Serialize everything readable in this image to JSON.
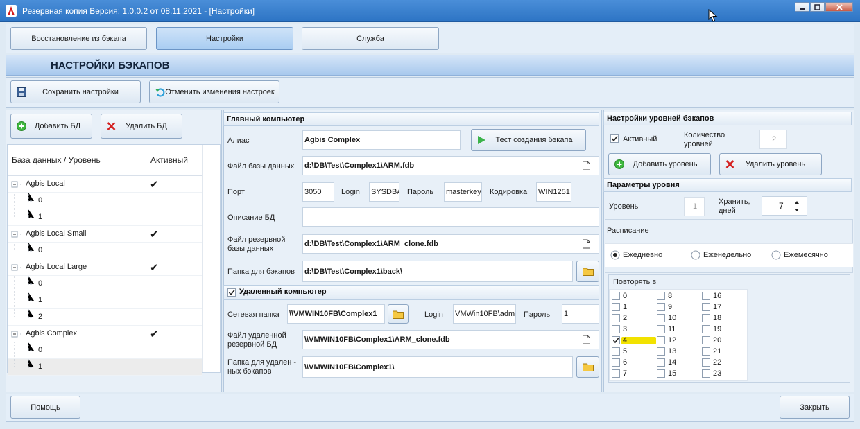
{
  "window": {
    "title": "Резервная копия   Версия: 1.0.0.2 от 08.11.2021 - [Настройки]"
  },
  "tabs": [
    "Восстановление из бэкапа",
    "Настройки",
    "Служба"
  ],
  "header": {
    "title": "НАСТРОЙКИ БЭКАПОВ"
  },
  "toolbar": {
    "save": "Сохранить настройки",
    "cancel": "Отменить изменения настроек"
  },
  "left": {
    "add_db": "Добавить БД",
    "del_db": "Удалить БД",
    "col_db": "База данных / Уровень",
    "col_active": "Активный",
    "rows": [
      {
        "label": "Agbis Local",
        "active": "✔"
      },
      {
        "label": "0",
        "active": ""
      },
      {
        "label": "1",
        "active": ""
      },
      {
        "label": "Agbis Local Small",
        "active": "✔"
      },
      {
        "label": "0",
        "active": ""
      },
      {
        "label": "Agbis Local Large",
        "active": "✔"
      },
      {
        "label": "0",
        "active": ""
      },
      {
        "label": "1",
        "active": ""
      },
      {
        "label": "2",
        "active": ""
      },
      {
        "label": "Agbis Complex",
        "active": "✔"
      },
      {
        "label": "0",
        "active": ""
      },
      {
        "label": "1",
        "active": ""
      }
    ]
  },
  "main": {
    "section": "Главный компьютер",
    "alias_label": "Алиас",
    "alias": "Agbis Complex",
    "test_btn": "Тест создания бэкапа",
    "dbfile_label": "Файл базы данных",
    "dbfile": "d:\\DB\\Test\\Complex1\\ARM.fdb",
    "port_label": "Порт",
    "port": "3050",
    "login_label": "Login",
    "login": "SYSDBA",
    "pass_label": "Пароль",
    "pass": "masterkey",
    "enc_label": "Кодировка",
    "enc": "WIN1251",
    "desc_label": "Описание БД",
    "desc": "",
    "backup_file_label_1": "Файл резервной",
    "backup_file_label_2": "базы данных",
    "backup_file": "d:\\DB\\Test\\Complex1\\ARM_clone.fdb",
    "backup_folder_label": "Папка для бэкапов",
    "backup_folder": "d:\\DB\\Test\\Complex1\\back\\"
  },
  "remote": {
    "section": "Удаленный компьютер",
    "net_label": "Сетевая папка",
    "net": "\\\\VMWIN10FB\\Complex1",
    "login_label": "Login",
    "login": "VMWin10FB\\adm",
    "pass_label": "Пароль",
    "pass": "1",
    "rfile_label_1": "Файл удаленной",
    "rfile_label_2": "резервной БД",
    "rfile": "\\\\VMWIN10FB\\Complex1\\ARM_clone.fdb",
    "rfolder_label_1": "Папка для удален -",
    "rfolder_label_2": "ных бэкапов",
    "rfolder": "\\\\VMWIN10FB\\Complex1\\"
  },
  "right": {
    "section": "Настройки уровней бэкапов",
    "active_label": "Активный",
    "count_label_1": "Количество",
    "count_label_2": "уровней",
    "count": "2",
    "add_level": "Добавить уровень",
    "del_level": "Удалить уровень",
    "params_section": "Параметры уровня",
    "level_label": "Уровень",
    "level": "1",
    "keep_label_1": "Хранить,",
    "keep_label_2": "дней",
    "keep": "7",
    "schedule_label": "Расписание",
    "daily": "Ежедневно",
    "weekly": "Еженедельно",
    "monthly": "Ежемесячно",
    "repeat_label": "Повторять в",
    "hours": [
      "0",
      "1",
      "2",
      "3",
      "4",
      "5",
      "6",
      "7",
      "8",
      "9",
      "10",
      "11",
      "12",
      "13",
      "14",
      "15",
      "16",
      "17",
      "18",
      "19",
      "20",
      "21",
      "22",
      "23"
    ],
    "checked_hour": "4"
  },
  "footer": {
    "help": "Помощь",
    "close": "Закрыть"
  },
  "colors": {
    "titlebar": "#2d74c4",
    "highlight": "#f2e200",
    "accent_green": "#3fb83f",
    "accent_red": "#d42020"
  }
}
